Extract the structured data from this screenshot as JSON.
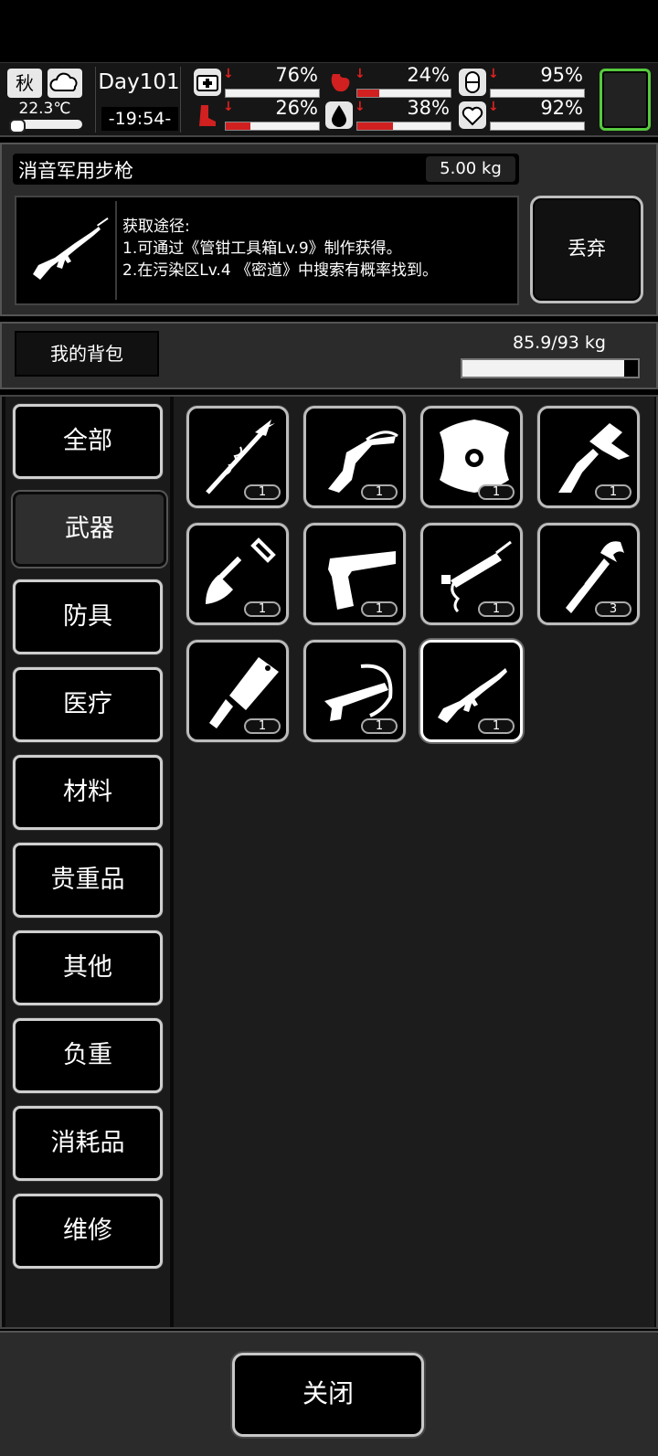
{
  "status": {
    "season": "秋",
    "temperature": "22.3℃",
    "day": "Day101",
    "time": "-19:54-",
    "stats": [
      {
        "icon": "medkit-icon",
        "value": "76%",
        "level": 0.76
      },
      {
        "icon": "stomach-icon",
        "value": "24%",
        "level": 0.24
      },
      {
        "icon": "pill-icon",
        "value": "95%",
        "level": 0.95
      },
      {
        "icon": "boot-icon",
        "value": "26%",
        "level": 0.26
      },
      {
        "icon": "water-drop-icon",
        "value": "38%",
        "level": 0.38
      },
      {
        "icon": "heart-icon",
        "value": "92%",
        "level": 0.92
      }
    ],
    "accent_green": "#56c93e",
    "alert_red": "#d02020"
  },
  "detail": {
    "name": "消音军用步枪",
    "weight": "5.00 kg",
    "source_title": "获取途径:",
    "source_1": "1.可通过《管钳工具箱Lv.9》制作获得。",
    "source_2": "2.在污染区Lv.4 《密道》中搜索有概率找到。",
    "discard_label": "丢弃"
  },
  "backpack": {
    "label": "我的背包",
    "capacity": "85.9/93 kg",
    "capacity_fraction": 0.924
  },
  "categories": [
    "全部",
    "武器",
    "防具",
    "医疗",
    "材料",
    "贵重品",
    "其他",
    "负重",
    "消耗品",
    "维修"
  ],
  "active_category": "武器",
  "items": [
    {
      "icon": "wrapped-spear-icon",
      "count": "1"
    },
    {
      "icon": "crossbow-stock-icon",
      "count": "1"
    },
    {
      "icon": "shield-icon",
      "count": "1"
    },
    {
      "icon": "tomahawk-icon",
      "count": "1"
    },
    {
      "icon": "shovel-icon",
      "count": "1"
    },
    {
      "icon": "pistol-icon",
      "count": "1"
    },
    {
      "icon": "nail-gun-icon",
      "count": "1"
    },
    {
      "icon": "pipe-wrench-icon",
      "count": "3"
    },
    {
      "icon": "cleaver-icon",
      "count": "1"
    },
    {
      "icon": "crossbow-icon",
      "count": "1"
    },
    {
      "icon": "rifle-icon",
      "count": "1"
    }
  ],
  "close_label": "关闭"
}
